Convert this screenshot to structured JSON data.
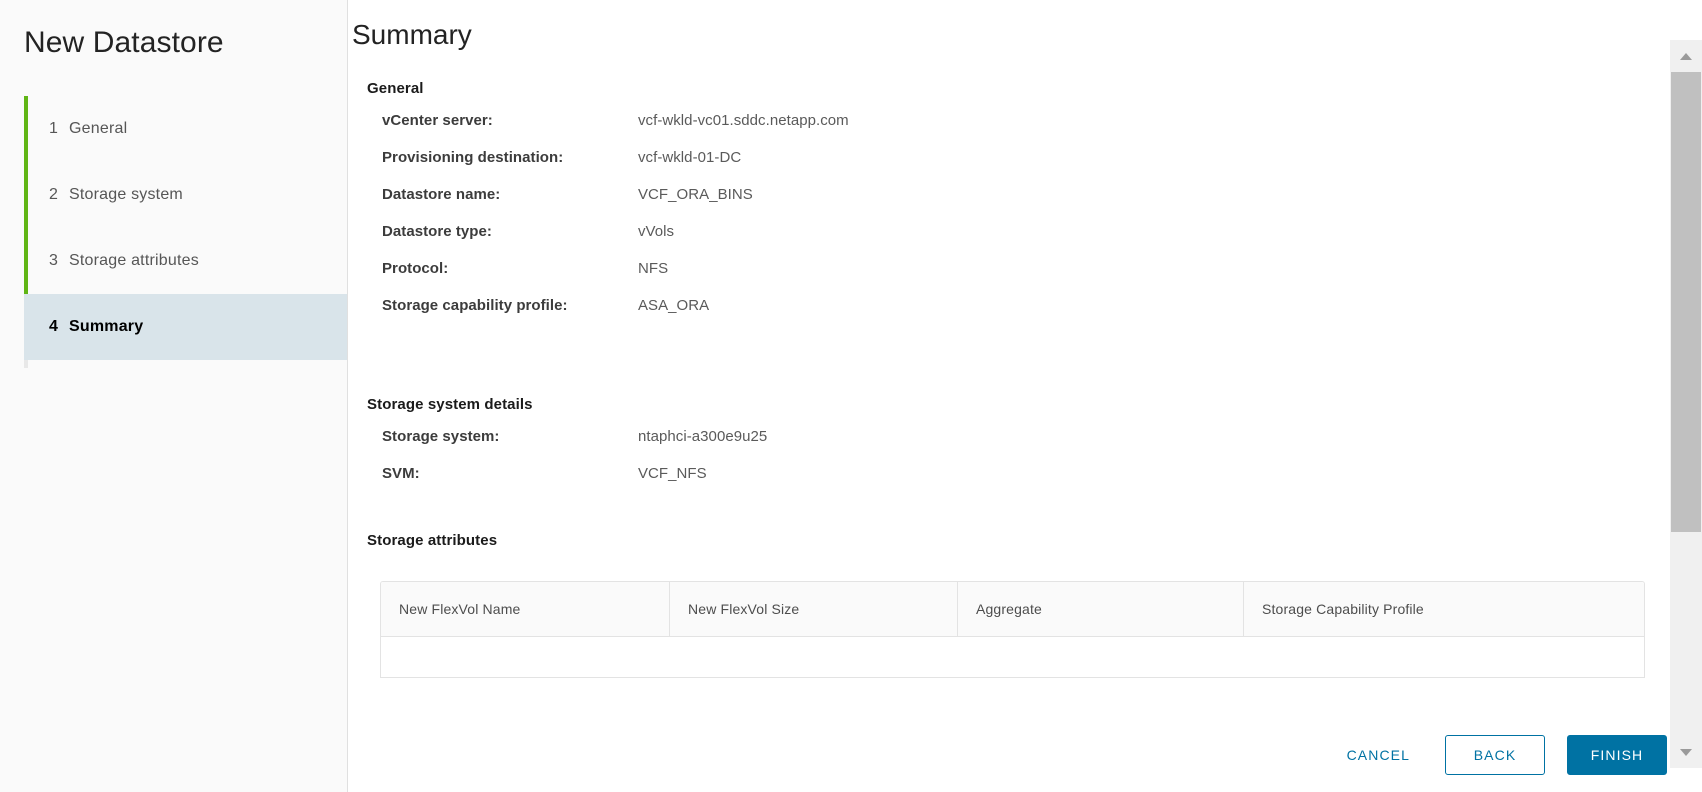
{
  "wizard": {
    "title": "New Datastore",
    "steps": [
      {
        "num": "1",
        "label": "General",
        "state": "complete"
      },
      {
        "num": "2",
        "label": "Storage system",
        "state": "complete"
      },
      {
        "num": "3",
        "label": "Storage attributes",
        "state": "complete"
      },
      {
        "num": "4",
        "label": "Summary",
        "state": "active"
      }
    ]
  },
  "page": {
    "title": "Summary"
  },
  "general": {
    "heading": "General",
    "rows": [
      {
        "label": "vCenter server:",
        "value": "vcf-wkld-vc01.sddc.netapp.com"
      },
      {
        "label": "Provisioning destination:",
        "value": "vcf-wkld-01-DC"
      },
      {
        "label": "Datastore name:",
        "value": "VCF_ORA_BINS"
      },
      {
        "label": "Datastore type:",
        "value": "vVols"
      },
      {
        "label": "Protocol:",
        "value": "NFS"
      },
      {
        "label": "Storage capability profile:",
        "value": "ASA_ORA"
      }
    ]
  },
  "storage_system_details": {
    "heading": "Storage system details",
    "rows": [
      {
        "label": "Storage system:",
        "value": "ntaphci-a300e9u25"
      },
      {
        "label": "SVM:",
        "value": "VCF_NFS"
      }
    ]
  },
  "storage_attributes": {
    "heading": "Storage attributes",
    "columns": [
      "New FlexVol Name",
      "New FlexVol Size",
      "Aggregate",
      "Storage Capability Profile"
    ],
    "rows": []
  },
  "footer": {
    "cancel_label": "CANCEL",
    "back_label": "BACK",
    "finish_label": "FINISH"
  },
  "colors": {
    "accent_blue": "#0072a3",
    "progress_green": "#60b515",
    "active_step_bg": "#d9e4ea"
  }
}
